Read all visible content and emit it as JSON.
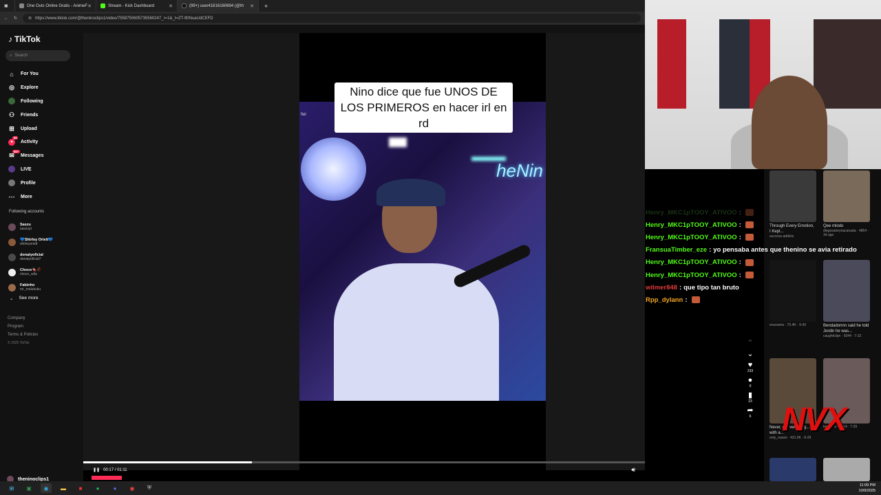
{
  "browser": {
    "tabs": [
      {
        "label": "One Outs Online Gratis - AnimeF"
      },
      {
        "label": "Stream - Kick Dashboard"
      },
      {
        "label": "(99+) user41616160694 (@th"
      }
    ],
    "url": "https://www.tiktok.com/@theninoclips1/video/7558750605735560247_r=1&_t=ZT-90NuaUdCEFD"
  },
  "tiktok": {
    "logo": "TikTok",
    "search_placeholder": "Search",
    "nav": [
      {
        "label": "For You",
        "icon": "home-icon"
      },
      {
        "label": "Explore",
        "icon": "compass-icon"
      },
      {
        "label": "Following",
        "icon": "following-icon"
      },
      {
        "label": "Friends",
        "icon": "friends-icon"
      },
      {
        "label": "Upload",
        "icon": "upload-icon"
      },
      {
        "label": "Activity",
        "icon": "activity-icon",
        "badge": "99"
      },
      {
        "label": "Messages",
        "icon": "messages-icon",
        "badge": "99+"
      },
      {
        "label": "LIVE",
        "icon": "live-icon"
      },
      {
        "label": "Profile",
        "icon": "profile-icon"
      },
      {
        "label": "More",
        "icon": "more-icon"
      }
    ],
    "following_title": "Following accounts",
    "accounts": [
      {
        "name": "Saszu",
        "handle": "saszuyt"
      },
      {
        "name": "💙Shirley Oriett💙",
        "handle": "shirleyoriett"
      },
      {
        "name": "donatyoficial",
        "handle": "donatyoficial7"
      },
      {
        "name": "Choco🍫🥀",
        "handle": "choco_wila"
      },
      {
        "name": "Fabinho",
        "handle": "mr_mulukuku"
      }
    ],
    "see_more": "See more",
    "footer": {
      "company": "Company",
      "program": "Program",
      "terms": "Terms & Policies",
      "copyright": "© 2025 TikTok"
    },
    "video": {
      "caption": "Nino dice que fue UNOS DE LOS PRIMEROS en hacer irl en rd",
      "watermark": "fiel",
      "neon": "heNin",
      "time": "00:17 / 01:11",
      "progress": 0.3,
      "author": "theninoclips1"
    },
    "actions": {
      "likes": "233",
      "comments": "0",
      "saves": "23",
      "shares": "6"
    }
  },
  "chat": [
    {
      "user": "Henry_MKC1pTOOY_ATIVOO",
      "text": "",
      "color": "#4a8a3a",
      "emote": true,
      "faded": true
    },
    {
      "user": "Henry_MKC1pTOOY_ATIVOO",
      "text": "",
      "color": "#53fc18",
      "emote": true
    },
    {
      "user": "Henry_MKC1pTOOY_ATIVOO",
      "text": "",
      "color": "#53fc18",
      "emote": true
    },
    {
      "user": "FransuaTimber_eze",
      "text": "yo pensaba antes que thenino se avia retirado",
      "color": "#53fc18"
    },
    {
      "user": "Henry_MKC1pTOOY_ATIVOO",
      "text": "",
      "color": "#53fc18",
      "emote": true
    },
    {
      "user": "Henry_MKC1pTOOY_ATIVOO",
      "text": "",
      "color": "#53fc18",
      "emote": true
    },
    {
      "user": "wilmer848",
      "text": "que tipo tan bruto",
      "color": "#e23b3b"
    },
    {
      "user": "Rpp_dylann",
      "text": "",
      "color": "#f5a623",
      "emote": true
    }
  ],
  "recs": [
    {
      "title": "Through Every Emotion, I Kept...",
      "meta": "success.addicts"
    },
    {
      "title": "Qee mlodo",
      "meta": "diegosaireynacanada · 4864 · 3d ago"
    },
    {
      "title": "",
      "meta": "enzowms · 75.4K · 9-30"
    },
    {
      "title": "Bendadonnn said he told Jordin he was...",
      "meta": "caughtclipn · 9344 · 7-22"
    },
    {
      "title": "Never, e... verbal fig... with a...",
      "meta": "only_roasts · 431.9K · 8-29"
    },
    {
      "title": "",
      "meta": "tonoteve · 6314 · 7-29"
    }
  ],
  "overlay": {
    "brand": "NVX"
  },
  "clock": {
    "time": "11:09 PM",
    "date": "10/9/2025"
  }
}
